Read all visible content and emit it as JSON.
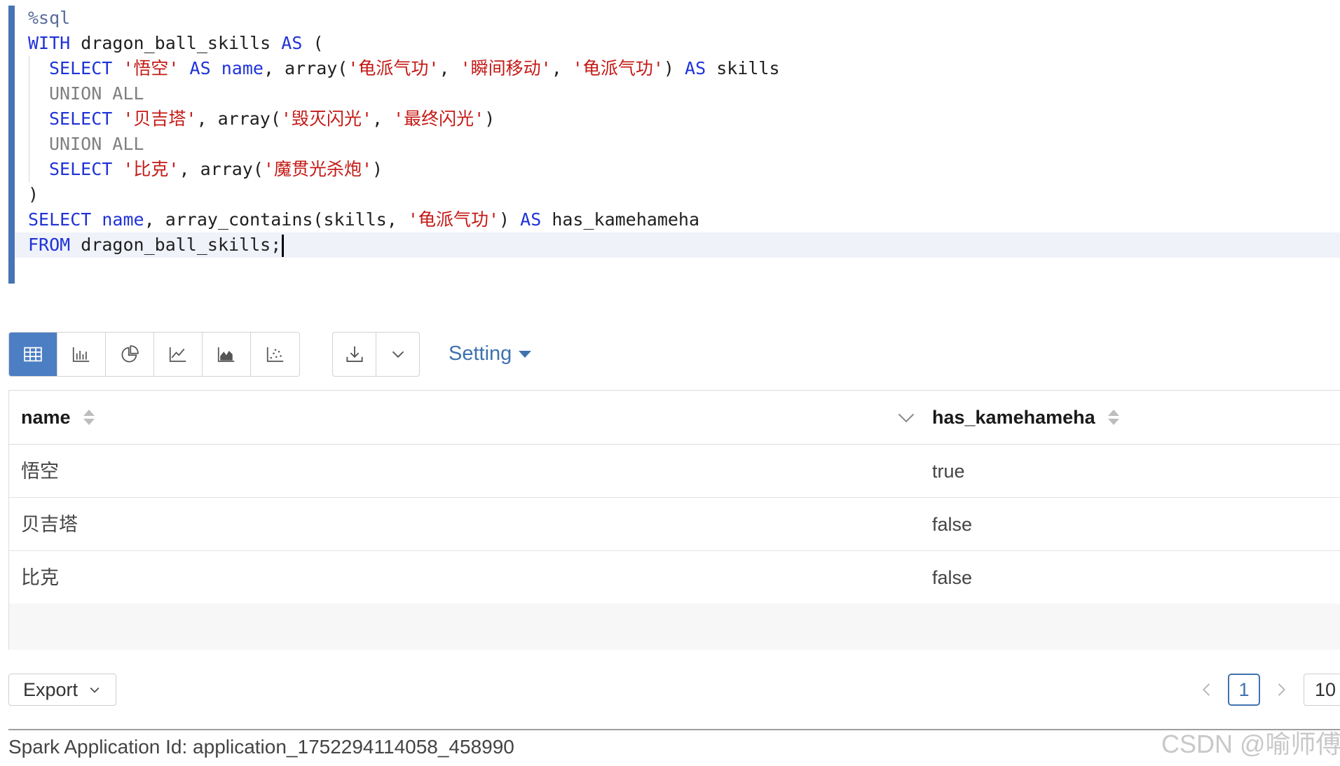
{
  "editor": {
    "magic": "%sql",
    "tokens": {
      "with": "WITH",
      "cte_name": "dragon_ball_skills",
      "as": "AS",
      "open_paren": "(",
      "close_paren": ")",
      "select": "SELECT",
      "union_all": "UNION ALL",
      "name_col": "name",
      "array_fn": "array(",
      "skills_col": "skills",
      "contains_fn": "array_contains(",
      "has_kamehameha": "has_kamehameha",
      "from": "FROM",
      "from_table": "dragon_ball_skills;",
      "comma": ", ",
      "close": ")",
      "skills_arg": "skills, "
    },
    "strings": {
      "goku": "'悟空'",
      "kamehameha": "'龟派气功'",
      "instant_transmission": "'瞬间移动'",
      "vegeta": "'贝吉塔'",
      "galick_gun": "'毁灭闪光'",
      "final_flash": "'最终闪光'",
      "piccolo": "'比克'",
      "special_beam_cannon": "'魔贯光杀炮'"
    }
  },
  "toolbar": {
    "viz_icons": [
      "table-icon",
      "bar-chart-icon",
      "pie-chart-icon",
      "line-chart-icon",
      "area-chart-icon",
      "scatter-chart-icon"
    ],
    "download_icon": "download-icon",
    "dropdown_icon": "chevron-down-icon",
    "setting_label": "Setting",
    "active_color": "#4c7ec3"
  },
  "table": {
    "columns": [
      "name",
      "has_kamehameha"
    ],
    "rows": [
      [
        "悟空",
        "true"
      ],
      [
        "贝吉塔",
        "false"
      ],
      [
        "比克",
        "false"
      ]
    ]
  },
  "footer": {
    "export_label": "Export",
    "current_page": "1",
    "page_size": "10",
    "app_id": "Spark Application Id: application_1752294114058_458990",
    "watermark": "CSDN @喻师傅"
  }
}
